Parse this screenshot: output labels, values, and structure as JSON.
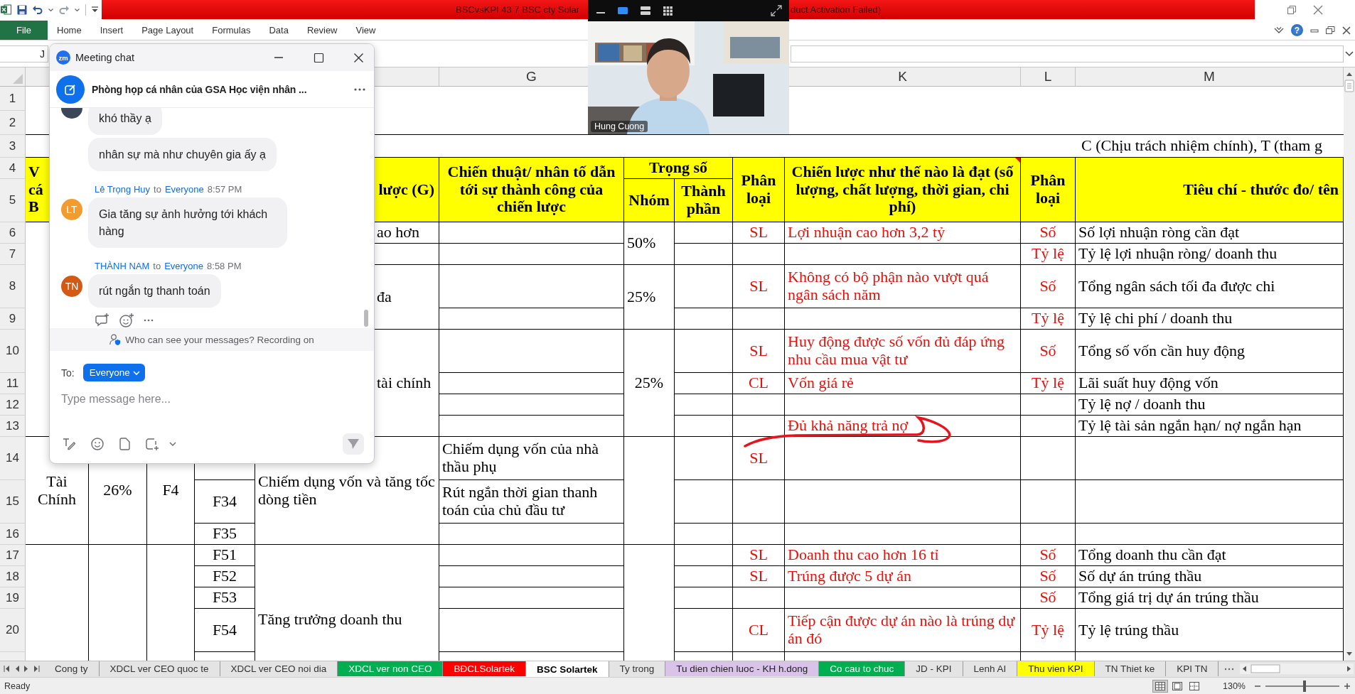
{
  "title_bar": {
    "title_start": "BSCvsKPI 43 7 BSC cty Solar",
    "title_end": "duct Activation Failed)"
  },
  "ribbon": {
    "tabs": [
      {
        "label": "File",
        "kind": "file"
      },
      {
        "label": "Home",
        "kind": "tab"
      },
      {
        "label": "Insert",
        "kind": "tab"
      },
      {
        "label": "Page Layout",
        "kind": "tab"
      },
      {
        "label": "Formulas",
        "kind": "tab"
      },
      {
        "label": "Data",
        "kind": "tab"
      },
      {
        "label": "Review",
        "kind": "tab"
      },
      {
        "label": "View",
        "kind": "tab"
      }
    ],
    "help": "?"
  },
  "formula_bar": {
    "name_box": "J"
  },
  "sheet": {
    "column_headers": [
      "G",
      "K",
      "L",
      "M"
    ],
    "row_headers": [
      "1",
      "2",
      "3",
      "4",
      "5",
      "6",
      "7",
      "8",
      "9",
      "10",
      "11",
      "12",
      "13",
      "14",
      "15",
      "16",
      "17",
      "18",
      "19",
      "20"
    ],
    "cells": [
      {
        "kind": "note",
        "text": "C (Chịu trách nhiệm chính), T (tham g"
      },
      {
        "kind": "header-lead",
        "text": "V\ncá\nB"
      },
      {
        "kind": "header-remnant",
        "text": "lược (G)"
      },
      {
        "kind": "header",
        "text": "Chiến thuật/ nhân tố dẫn tới sự thành công của chiến lược"
      },
      {
        "kind": "header",
        "text": "Trọng số"
      },
      {
        "kind": "header",
        "text": "Phân loại"
      },
      {
        "kind": "header",
        "text": "Chiến lược như thế nào là đạt (số lượng, chất lượng, thời gian, chi phí)",
        "comment": true
      },
      {
        "kind": "header",
        "text": "Phân loại"
      },
      {
        "kind": "header-remnant",
        "text": "Tiêu chí - thước đo/ tên"
      },
      {
        "kind": "header",
        "text": "Nhóm"
      },
      {
        "kind": "header",
        "text": "Thành phần"
      },
      {
        "kind": "remnant",
        "text": "ao hơn"
      },
      {
        "kind": "text",
        "text": "50%"
      },
      {
        "kind": "category",
        "text": "SL"
      },
      {
        "kind": "target",
        "text": "Lợi nhuận cao hơn 3,2 tỷ"
      },
      {
        "kind": "category",
        "text": "Số"
      },
      {
        "kind": "text",
        "text": "Số lợi nhuận ròng cần đạt"
      },
      {
        "kind": "category",
        "text": "Tỷ lệ"
      },
      {
        "kind": "text",
        "text": "Tỷ lệ lợi nhuận ròng/ doanh thu"
      },
      {
        "kind": "remnant",
        "text": "đa"
      },
      {
        "kind": "text",
        "text": "25%"
      },
      {
        "kind": "category",
        "text": "SL"
      },
      {
        "kind": "target",
        "text": "Không có bộ phận nào vượt quá ngân sách năm"
      },
      {
        "kind": "category",
        "text": "Số"
      },
      {
        "kind": "text",
        "text": "Tổng ngân sách tối đa được chi"
      },
      {
        "kind": "category",
        "text": "Tỷ lệ"
      },
      {
        "kind": "text",
        "text": "Tỷ lệ chi phí / doanh thu"
      },
      {
        "kind": "remnant",
        "text": "tài chính"
      },
      {
        "kind": "center",
        "text": "25%"
      },
      {
        "kind": "category",
        "text": "SL"
      },
      {
        "kind": "target",
        "text": "Huy động được số vốn đủ đáp ứng nhu cầu mua vật tư"
      },
      {
        "kind": "category",
        "text": "Số"
      },
      {
        "kind": "text",
        "text": "Tổng số vốn cần huy động"
      },
      {
        "kind": "category",
        "text": "CL"
      },
      {
        "kind": "target",
        "text": "Vốn giá rẻ"
      },
      {
        "kind": "category",
        "text": "Tỷ lệ"
      },
      {
        "kind": "text",
        "text": "Lãi suất huy động vốn"
      },
      {
        "kind": "text",
        "text": "Tỷ lệ nợ / doanh thu"
      },
      {
        "kind": "target",
        "text": "Đủ khả năng trả nợ"
      },
      {
        "kind": "text",
        "text": "Tỷ lệ tài sản ngắn hạn/ nợ ngắn hạn"
      },
      {
        "kind": "center",
        "text": "Tài Chính"
      },
      {
        "kind": "center",
        "text": "26%"
      },
      {
        "kind": "center",
        "text": "F4"
      },
      {
        "kind": "text",
        "text": "Chiếm dụng vốn và tăng tốc dòng tiền"
      },
      {
        "kind": "text",
        "text": "Chiếm dụng vốn của nhà thầu phụ"
      },
      {
        "kind": "category",
        "text": "SL"
      },
      {
        "kind": "center",
        "text": "F34"
      },
      {
        "kind": "text",
        "text": "Rút ngắn thời gian thanh toán của chủ đầu tư"
      },
      {
        "kind": "center",
        "text": "F35"
      },
      {
        "kind": "center",
        "text": "F51"
      },
      {
        "kind": "text",
        "text": "Tăng trưởng doanh thu"
      },
      {
        "kind": "category",
        "text": "SL"
      },
      {
        "kind": "target",
        "text": "Doanh thu cao hơn 16 tỉ"
      },
      {
        "kind": "category",
        "text": "Số"
      },
      {
        "kind": "text",
        "text": "Tổng doanh thu cần đạt"
      },
      {
        "kind": "center",
        "text": "F52"
      },
      {
        "kind": "category",
        "text": "SL"
      },
      {
        "kind": "target",
        "text": "Trúng được 5 dự án"
      },
      {
        "kind": "category",
        "text": "Số"
      },
      {
        "kind": "text",
        "text": "Số dự án trúng thầu"
      },
      {
        "kind": "center",
        "text": "F53"
      },
      {
        "kind": "category",
        "text": "Số"
      },
      {
        "kind": "text",
        "text": "Tổng giá trị dự án trúng thầu"
      },
      {
        "kind": "center",
        "text": "F54"
      },
      {
        "kind": "category",
        "text": "CL"
      },
      {
        "kind": "target",
        "text": "Tiếp cận được dự án nào là trúng dự án đó"
      },
      {
        "kind": "category",
        "text": "Tỷ lệ"
      },
      {
        "kind": "text",
        "text": "Tỷ lệ trúng thầu"
      }
    ]
  },
  "sheet_tabs": [
    {
      "label": "Cong ty",
      "selected": false
    },
    {
      "label": "XDCL ver CEO quoc te",
      "selected": false
    },
    {
      "label": "XDCL ver CEO noi dia",
      "selected": false
    },
    {
      "label": "XDCL ver non CEO",
      "selected": false,
      "color": "#00b050"
    },
    {
      "label": "BĐCLSolartek",
      "selected": false,
      "color": "#ff0000"
    },
    {
      "label": "BSC Solartek",
      "selected": true
    },
    {
      "label": "Ty trong",
      "selected": false
    },
    {
      "label": "Tu dien chien luoc - KH h.dong",
      "selected": false,
      "color": "#d9c3e9"
    },
    {
      "label": "Co cau to chuc",
      "selected": false,
      "color": "#00b050"
    },
    {
      "label": "JD - KPI",
      "selected": false
    },
    {
      "label": "Lenh AI",
      "selected": false
    },
    {
      "label": "Thu vien KPI",
      "selected": false,
      "color": "#ffff00"
    },
    {
      "label": "TN Thiet ke",
      "selected": false
    },
    {
      "label": "KPI TN",
      "selected": false
    }
  ],
  "status_bar": {
    "status": "Ready",
    "view_buttons": [
      {
        "selected": true
      },
      {
        "selected": false
      },
      {
        "selected": false
      }
    ],
    "zoom": "130%",
    "zoom_slider": {
      "level": 0.53
    }
  },
  "chat": {
    "logo": "zm",
    "title": "Meeting chat",
    "meeting": "Phòng họp cá nhân của GSA Học viện nhân ...",
    "messages": [
      {
        "kind": "clipped",
        "color": "#3b4658",
        "text": "khó thầy ạ"
      },
      {
        "kind": "continuation",
        "text": "nhân sự mà như chuyên gia ấy ạ"
      },
      {
        "kind": "message",
        "sender": "Lê Trọng Huy",
        "link_word": "to",
        "recipient": "Everyone",
        "time": "8:57 PM",
        "initials": "LT",
        "color": "#f29b2e",
        "text": "Gia tăng sự ảnh hưởng tới khách hàng"
      },
      {
        "kind": "message",
        "sender": "THÀNH NAM",
        "link_word": "to",
        "recipient": "Everyone",
        "time": "8:58 PM",
        "initials": "TN",
        "color": "#d45a14",
        "text": "rút ngắn tg thanh toán"
      }
    ],
    "notice": "Who can see your messages? Recording on",
    "to_label": "To:",
    "recipient": "Everyone",
    "placeholder": "Type message here..."
  },
  "video": {
    "participant": "Hung Cuong"
  }
}
